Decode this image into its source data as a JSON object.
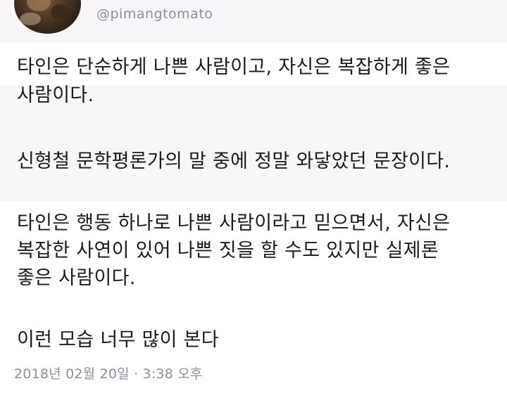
{
  "user": {
    "handle": "@pimangtomato"
  },
  "tweet": {
    "lines": [
      "타인은 단순하게 나쁜 사람이고, 자신은 복잡하게 좋은",
      "사람이다.",
      "신형철 문학평론가의 말 중에 정말 와닿았던 문장이다.",
      "타인은 행동 하나로 나쁜 사람이라고 믿으면서, 자신은",
      "복잡한 사연이 있어 나쁜 짓을 할 수도 있지만 실제론",
      "좋은 사람이다.",
      "이런 모습 너무 많이 본다"
    ],
    "timestamp": "2018년 02월 20일 · 3:38 오후"
  }
}
